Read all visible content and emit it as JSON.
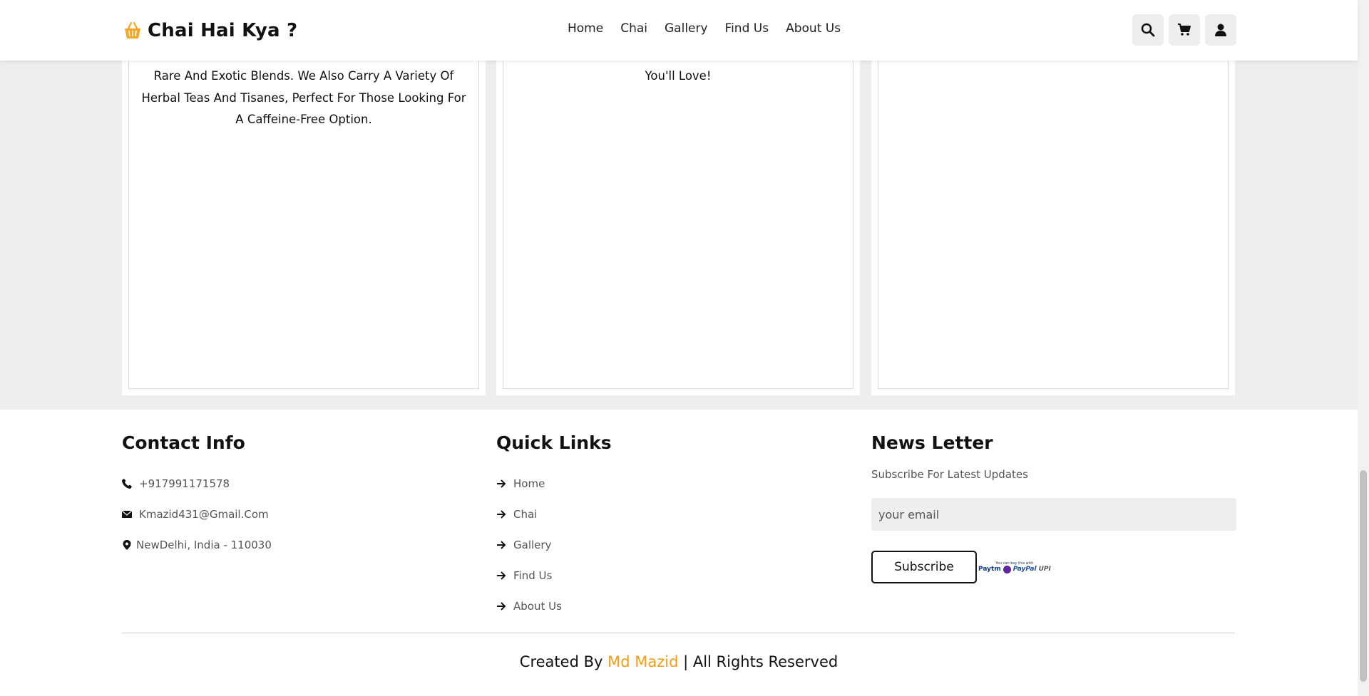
{
  "header": {
    "brand": "Chai Hai Kya ?",
    "nav": [
      "Home",
      "Chai",
      "Gallery",
      "Find Us",
      "About Us"
    ]
  },
  "cards": {
    "card1_lines": [
      "Rare And Exotic Blends. We Also Carry A Variety Of",
      "Herbal Teas And Tisanes, Perfect For Those Looking For",
      "A Caffeine-Free Option."
    ],
    "card2_lines": [
      "You'll Love!"
    ]
  },
  "footer": {
    "contact": {
      "title": "Contact Info",
      "phone": "+917991171578",
      "email": "Kmazid431@Gmail.Com",
      "address": "NewDelhi, India - 110030"
    },
    "quick_links": {
      "title": "Quick Links",
      "links": [
        "Home",
        "Chai",
        "Gallery",
        "Find Us",
        "About Us"
      ]
    },
    "newsletter": {
      "title": "News Letter",
      "subtitle": "Subscribe For Latest Updates",
      "placeholder": "your email",
      "button": "Subscribe",
      "payment_caption": "You can buy this with",
      "payment_brands": [
        "Paytm",
        "PayPal",
        "UPI"
      ]
    },
    "credit": {
      "prefix": "Created By ",
      "author": "Md Mazid",
      "suffix": " | All Rights Reserved"
    }
  },
  "colors": {
    "accent": "#f39c12",
    "background": "#eeeeee"
  }
}
